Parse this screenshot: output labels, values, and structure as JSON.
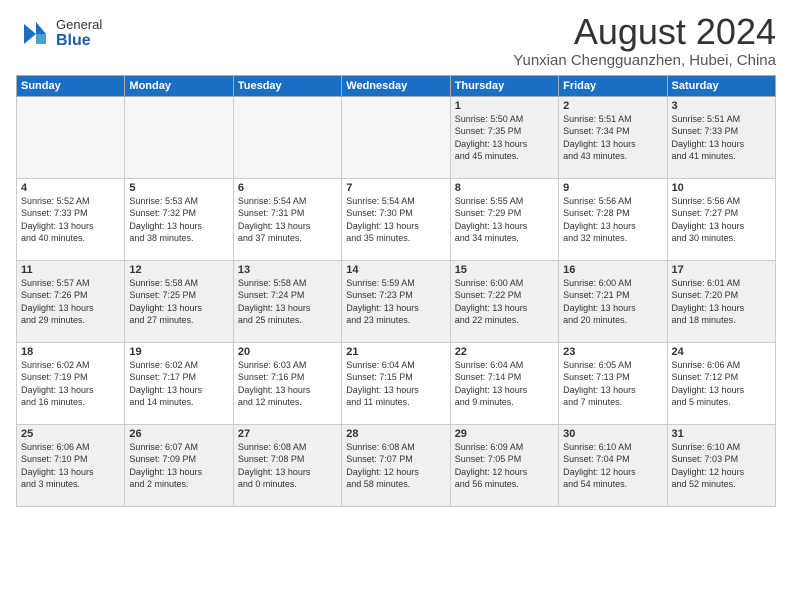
{
  "header": {
    "logo": {
      "general": "General",
      "blue": "Blue"
    },
    "title": "August 2024",
    "location": "Yunxian Chengguanzhen, Hubei, China"
  },
  "days_of_week": [
    "Sunday",
    "Monday",
    "Tuesday",
    "Wednesday",
    "Thursday",
    "Friday",
    "Saturday"
  ],
  "weeks": [
    [
      {
        "day": "",
        "info": "",
        "empty": true
      },
      {
        "day": "",
        "info": "",
        "empty": true
      },
      {
        "day": "",
        "info": "",
        "empty": true
      },
      {
        "day": "",
        "info": "",
        "empty": true
      },
      {
        "day": "1",
        "info": "Sunrise: 5:50 AM\nSunset: 7:35 PM\nDaylight: 13 hours\nand 45 minutes."
      },
      {
        "day": "2",
        "info": "Sunrise: 5:51 AM\nSunset: 7:34 PM\nDaylight: 13 hours\nand 43 minutes."
      },
      {
        "day": "3",
        "info": "Sunrise: 5:51 AM\nSunset: 7:33 PM\nDaylight: 13 hours\nand 41 minutes."
      }
    ],
    [
      {
        "day": "4",
        "info": "Sunrise: 5:52 AM\nSunset: 7:33 PM\nDaylight: 13 hours\nand 40 minutes."
      },
      {
        "day": "5",
        "info": "Sunrise: 5:53 AM\nSunset: 7:32 PM\nDaylight: 13 hours\nand 38 minutes."
      },
      {
        "day": "6",
        "info": "Sunrise: 5:54 AM\nSunset: 7:31 PM\nDaylight: 13 hours\nand 37 minutes."
      },
      {
        "day": "7",
        "info": "Sunrise: 5:54 AM\nSunset: 7:30 PM\nDaylight: 13 hours\nand 35 minutes."
      },
      {
        "day": "8",
        "info": "Sunrise: 5:55 AM\nSunset: 7:29 PM\nDaylight: 13 hours\nand 34 minutes."
      },
      {
        "day": "9",
        "info": "Sunrise: 5:56 AM\nSunset: 7:28 PM\nDaylight: 13 hours\nand 32 minutes."
      },
      {
        "day": "10",
        "info": "Sunrise: 5:56 AM\nSunset: 7:27 PM\nDaylight: 13 hours\nand 30 minutes."
      }
    ],
    [
      {
        "day": "11",
        "info": "Sunrise: 5:57 AM\nSunset: 7:26 PM\nDaylight: 13 hours\nand 29 minutes."
      },
      {
        "day": "12",
        "info": "Sunrise: 5:58 AM\nSunset: 7:25 PM\nDaylight: 13 hours\nand 27 minutes."
      },
      {
        "day": "13",
        "info": "Sunrise: 5:58 AM\nSunset: 7:24 PM\nDaylight: 13 hours\nand 25 minutes."
      },
      {
        "day": "14",
        "info": "Sunrise: 5:59 AM\nSunset: 7:23 PM\nDaylight: 13 hours\nand 23 minutes."
      },
      {
        "day": "15",
        "info": "Sunrise: 6:00 AM\nSunset: 7:22 PM\nDaylight: 13 hours\nand 22 minutes."
      },
      {
        "day": "16",
        "info": "Sunrise: 6:00 AM\nSunset: 7:21 PM\nDaylight: 13 hours\nand 20 minutes."
      },
      {
        "day": "17",
        "info": "Sunrise: 6:01 AM\nSunset: 7:20 PM\nDaylight: 13 hours\nand 18 minutes."
      }
    ],
    [
      {
        "day": "18",
        "info": "Sunrise: 6:02 AM\nSunset: 7:19 PM\nDaylight: 13 hours\nand 16 minutes."
      },
      {
        "day": "19",
        "info": "Sunrise: 6:02 AM\nSunset: 7:17 PM\nDaylight: 13 hours\nand 14 minutes."
      },
      {
        "day": "20",
        "info": "Sunrise: 6:03 AM\nSunset: 7:16 PM\nDaylight: 13 hours\nand 12 minutes."
      },
      {
        "day": "21",
        "info": "Sunrise: 6:04 AM\nSunset: 7:15 PM\nDaylight: 13 hours\nand 11 minutes."
      },
      {
        "day": "22",
        "info": "Sunrise: 6:04 AM\nSunset: 7:14 PM\nDaylight: 13 hours\nand 9 minutes."
      },
      {
        "day": "23",
        "info": "Sunrise: 6:05 AM\nSunset: 7:13 PM\nDaylight: 13 hours\nand 7 minutes."
      },
      {
        "day": "24",
        "info": "Sunrise: 6:06 AM\nSunset: 7:12 PM\nDaylight: 13 hours\nand 5 minutes."
      }
    ],
    [
      {
        "day": "25",
        "info": "Sunrise: 6:06 AM\nSunset: 7:10 PM\nDaylight: 13 hours\nand 3 minutes."
      },
      {
        "day": "26",
        "info": "Sunrise: 6:07 AM\nSunset: 7:09 PM\nDaylight: 13 hours\nand 2 minutes."
      },
      {
        "day": "27",
        "info": "Sunrise: 6:08 AM\nSunset: 7:08 PM\nDaylight: 13 hours\nand 0 minutes."
      },
      {
        "day": "28",
        "info": "Sunrise: 6:08 AM\nSunset: 7:07 PM\nDaylight: 12 hours\nand 58 minutes."
      },
      {
        "day": "29",
        "info": "Sunrise: 6:09 AM\nSunset: 7:05 PM\nDaylight: 12 hours\nand 56 minutes."
      },
      {
        "day": "30",
        "info": "Sunrise: 6:10 AM\nSunset: 7:04 PM\nDaylight: 12 hours\nand 54 minutes."
      },
      {
        "day": "31",
        "info": "Sunrise: 6:10 AM\nSunset: 7:03 PM\nDaylight: 12 hours\nand 52 minutes."
      }
    ]
  ]
}
